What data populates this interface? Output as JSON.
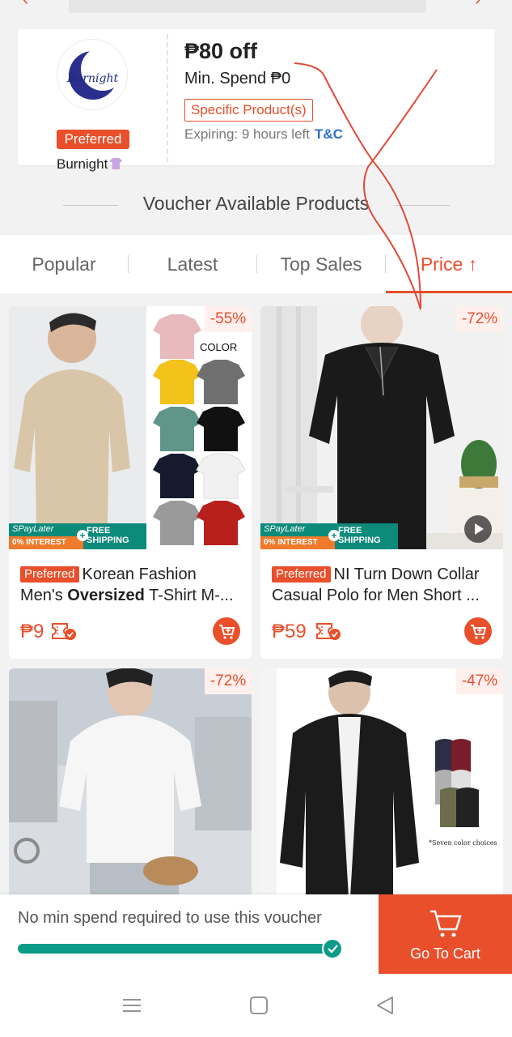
{
  "voucher": {
    "shop_preferred": "Preferred",
    "shop_name": "Burnight",
    "logo_text": "Burnight",
    "amount": "₱80 off",
    "min_spend": "Min. Spend ₱0",
    "scope": "Specific Product(s)",
    "expiry": "Expiring: 9 hours left",
    "tc": "T&C"
  },
  "section_title": "Voucher Available Products",
  "tabs": [
    {
      "label": "Popular"
    },
    {
      "label": "Latest"
    },
    {
      "label": "Top Sales"
    },
    {
      "label": "Price ↑"
    }
  ],
  "active_tab": "Price",
  "products": [
    {
      "discount": "-55%",
      "badge": "Preferred",
      "title_a": "Korean Fashion",
      "title_b": "Men's ",
      "title_bold": "Oversized",
      "title_c": " T-Shirt M-...",
      "price": "₱9",
      "color_label": "COLOR"
    },
    {
      "discount": "-72%",
      "badge": "Preferred",
      "title_a": "NI Turn Down Collar",
      "title_b": "Casual Polo for Men Short ...",
      "price": "₱59"
    },
    {
      "discount": "-72%"
    },
    {
      "discount": "-47%",
      "caption": "*Seven color choices"
    }
  ],
  "promo_banner": {
    "spaylater": "SPayLater",
    "interest": "0% INTEREST",
    "shipping_1": "FREE",
    "shipping_2": "SHIPPING"
  },
  "bottom_bar": {
    "message": "No min spend required to use this voucher",
    "progress": 1.0,
    "cta": "Go To Cart"
  },
  "colors": {
    "accent": "#e94f2b",
    "teal": "#0c9b87",
    "link": "#2e6fd0"
  },
  "icons": [
    "back-icon",
    "share-icon",
    "cart-icon",
    "voucher-icon",
    "play-icon",
    "check-icon",
    "menu-icon",
    "home-icon",
    "nav-back-icon"
  ]
}
